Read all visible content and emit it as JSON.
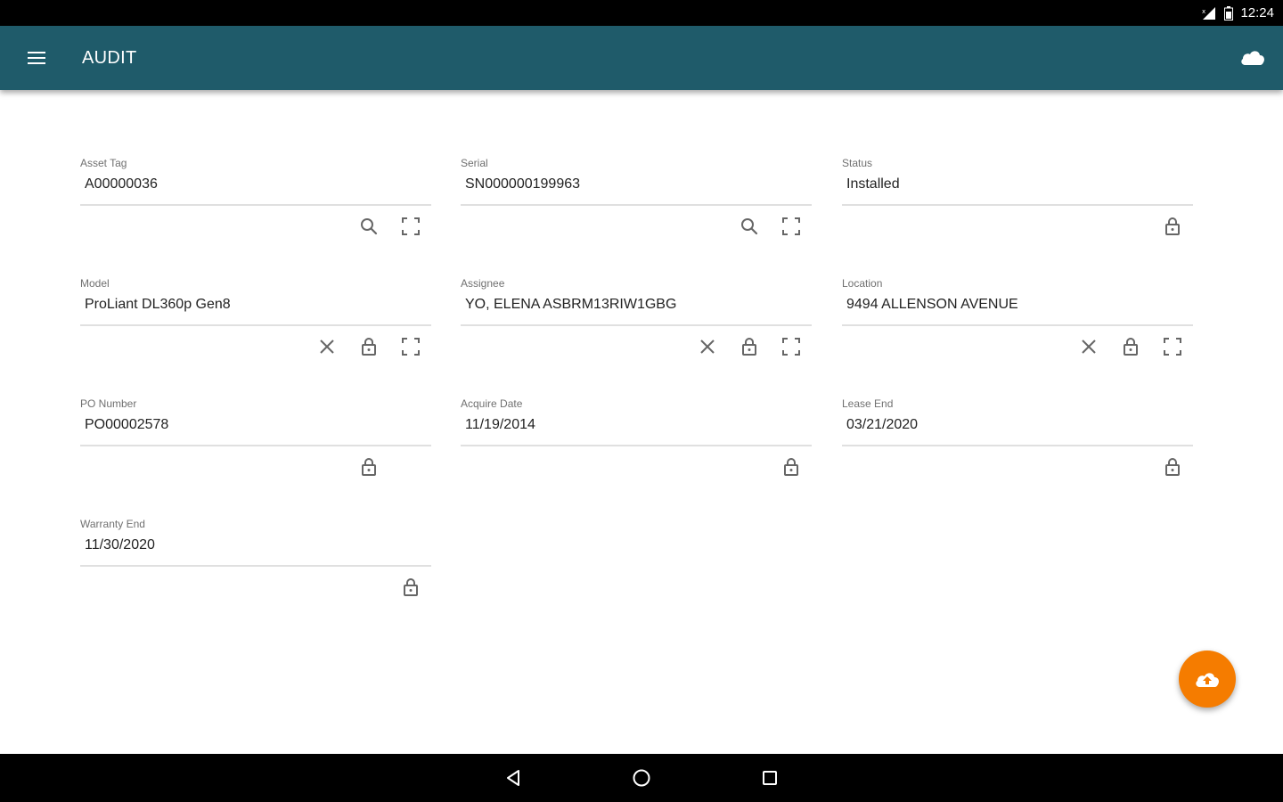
{
  "status_bar": {
    "time": "12:24",
    "signal_icon": "signal-icon",
    "battery_icon": "battery-icon"
  },
  "app_bar": {
    "title": "AUDIT",
    "menu_icon": "menu-icon",
    "sync_icon": "cloud-icon",
    "color": "#1f5b6a"
  },
  "fields": [
    {
      "label": "Asset Tag",
      "value": "A00000036",
      "icons": [
        "search-icon",
        "scan-icon"
      ]
    },
    {
      "label": "Serial",
      "value": "SN000000199963",
      "icons": [
        "search-icon",
        "scan-icon"
      ]
    },
    {
      "label": "Status",
      "value": "Installed",
      "icons": [
        "lock-icon"
      ]
    },
    {
      "label": "Model",
      "value": "ProLiant DL360p Gen8",
      "icons": [
        "close-icon",
        "lock-icon",
        "scan-icon"
      ]
    },
    {
      "label": "Assignee",
      "value": "YO, ELENA ASBRM13RIW1GBG",
      "icons": [
        "close-icon",
        "lock-icon",
        "scan-icon"
      ]
    },
    {
      "label": "Location",
      "value": "9494 ALLENSON AVENUE",
      "icons": [
        "close-icon",
        "lock-icon",
        "scan-icon"
      ]
    },
    {
      "label": "PO Number",
      "value": "PO00002578",
      "icons": [
        "lock-icon"
      ]
    },
    {
      "label": "Acquire Date",
      "value": "11/19/2014",
      "icons": [
        "lock-icon"
      ]
    },
    {
      "label": "Lease End",
      "value": "03/21/2020",
      "icons": [
        "lock-icon"
      ]
    },
    {
      "label": "Warranty End",
      "value": "11/30/2020",
      "icons": [
        "lock-icon"
      ]
    }
  ],
  "fab": {
    "icon": "cloud-upload-icon",
    "color": "#f57c00"
  },
  "nav_bar": {
    "back_icon": "back-icon",
    "home_icon": "home-icon",
    "recents_icon": "recents-icon"
  }
}
